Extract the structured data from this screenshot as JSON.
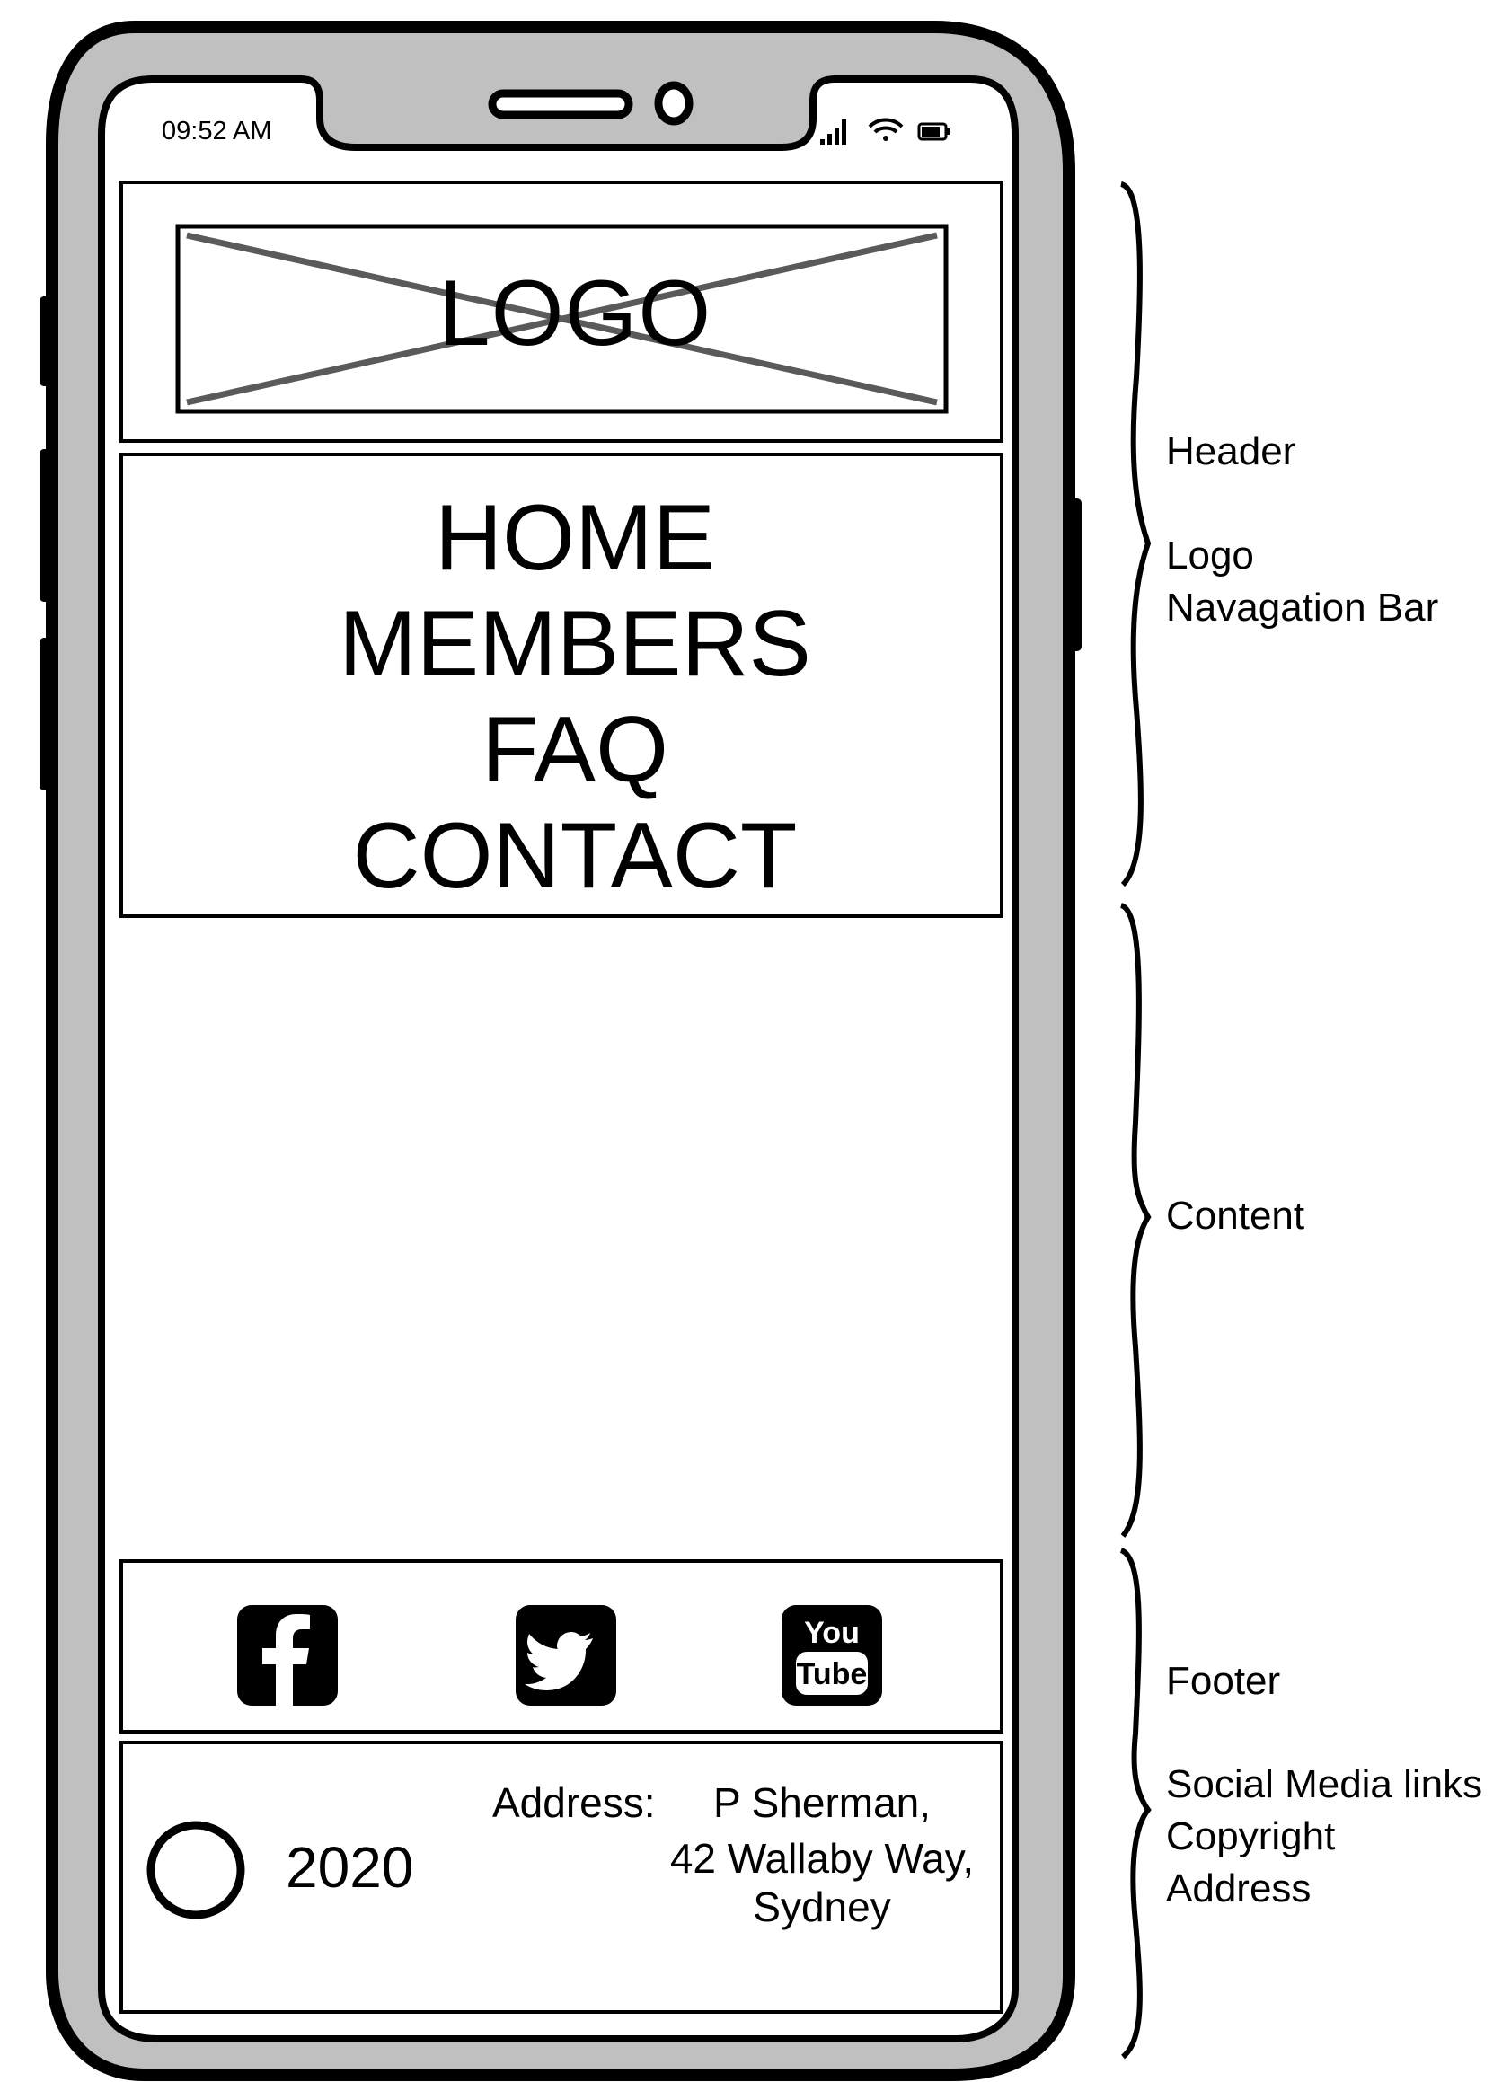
{
  "status_bar": {
    "time": "09:52 AM",
    "icons": [
      "signal-icon",
      "wifi-icon",
      "battery-icon"
    ]
  },
  "header": {
    "logo_placeholder_text": "LOGO",
    "nav_items": [
      "HOME",
      "MEMBERS",
      "FAQ",
      "CONTACT"
    ]
  },
  "footer": {
    "social_icons": [
      "facebook-icon",
      "twitter-icon",
      "youtube-icon"
    ],
    "youtube_lines": [
      "You",
      "Tube"
    ],
    "copyright_symbol": "©",
    "copyright_year": "2020",
    "address_label": "Address:",
    "address_lines": [
      "P Sherman,",
      "42 Wallaby Way,",
      "Sydney"
    ]
  },
  "annotations": {
    "header": {
      "title": "Header",
      "items": [
        "Logo",
        "Navagation Bar"
      ]
    },
    "content": {
      "title": "Content"
    },
    "footer": {
      "title": "Footer",
      "items": [
        "Social Media links",
        "Copyright",
        "Address"
      ]
    }
  },
  "colors": {
    "ink": "#000000",
    "bezel": "#c0c0c0",
    "screen": "#ffffff",
    "logo_cross": "#5a5a5a"
  }
}
